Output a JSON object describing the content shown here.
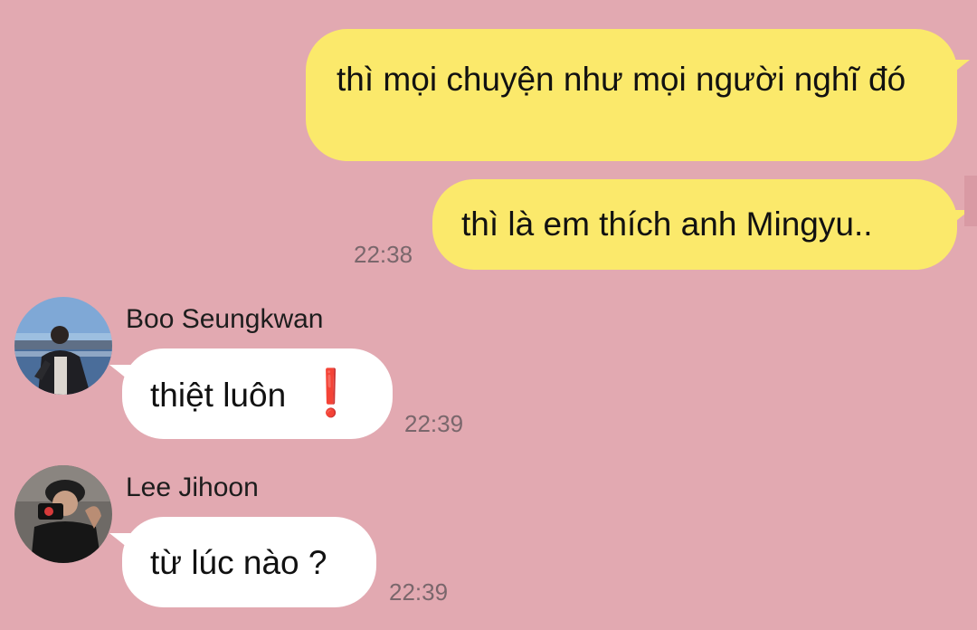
{
  "theme": {
    "background": "#e2a9b1",
    "outgoing_bubble": "#fbe96b",
    "incoming_bubble": "#ffffff",
    "alert_color": "#d61f3d"
  },
  "messages": [
    {
      "direction": "outgoing",
      "text": "thì mọi chuyện như mọi người nghĩ đó",
      "time": ""
    },
    {
      "direction": "outgoing",
      "text": "thì là em thích anh Mingyu..",
      "time": "22:38"
    },
    {
      "direction": "incoming",
      "sender": "Boo Seungkwan",
      "text": "thiệt luôn",
      "emoji": "❗",
      "emoji_icon": "red-exclamation-icon",
      "time": "22:39"
    },
    {
      "direction": "incoming",
      "sender": "Lee Jihoon",
      "text": "từ lúc nào ?",
      "time": "22:39"
    }
  ]
}
